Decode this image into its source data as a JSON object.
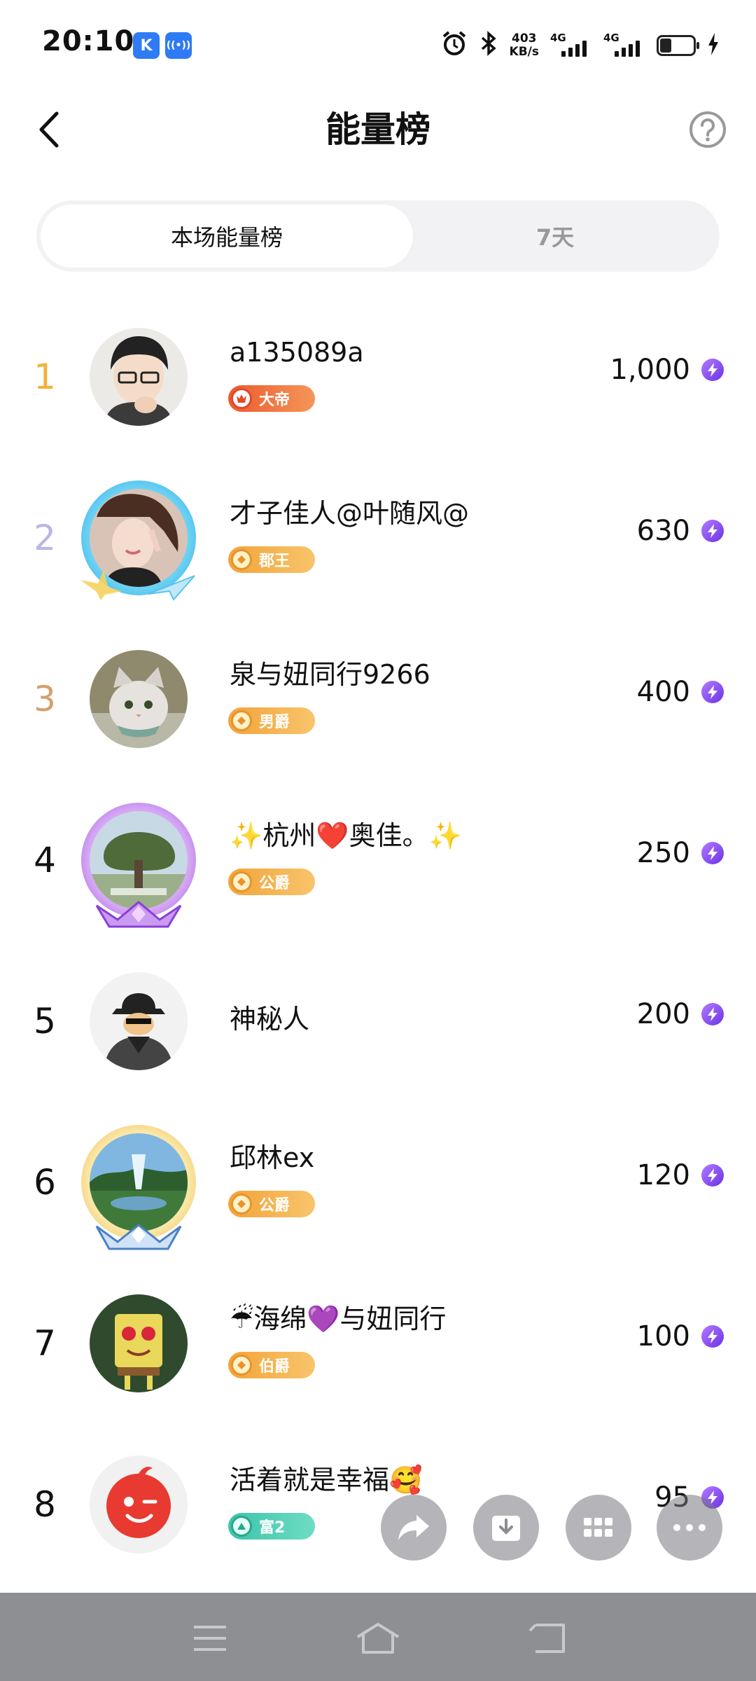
{
  "status_bar": {
    "time": "20:10",
    "app_badge_1": "K",
    "app_badge_2": "((•))",
    "net_speed_value": "403",
    "net_speed_unit": "KB/s",
    "network_1": "4G",
    "network_2": "4G",
    "icons": [
      "alarm-icon",
      "bluetooth-icon",
      "signal-icon",
      "battery-icon",
      "charging-icon"
    ]
  },
  "header": {
    "title": "能量榜",
    "back_icon": "chevron-left-icon",
    "help_icon": "question-circle-icon"
  },
  "tabs": [
    {
      "label": "本场能量榜",
      "active": true
    },
    {
      "label": "7天",
      "active": false
    }
  ],
  "leaderboard": [
    {
      "rank": "1",
      "name": "a135089a",
      "badge": "大帝",
      "badge_style": "red",
      "score": "1,000",
      "rank_color": "#f2b23a"
    },
    {
      "rank": "2",
      "name": "才子佳人@叶随风@",
      "badge": "郡王",
      "badge_style": "gold",
      "score": "630",
      "rank_color": "#b8b6e8"
    },
    {
      "rank": "3",
      "name": "泉与妞同行9266",
      "badge": "男爵",
      "badge_style": "gold",
      "score": "400",
      "rank_color": "#d5a06a"
    },
    {
      "rank": "4",
      "name": "✨杭州❤️奥佳。✨",
      "badge": "公爵",
      "badge_style": "gold",
      "score": "250",
      "rank_color": "#111111"
    },
    {
      "rank": "5",
      "name": "神秘人",
      "badge": "",
      "badge_style": "none",
      "score": "200",
      "rank_color": "#111111"
    },
    {
      "rank": "6",
      "name": "邱林ex",
      "badge": "公爵",
      "badge_style": "gold",
      "score": "120",
      "rank_color": "#111111"
    },
    {
      "rank": "7",
      "name": "☔海绵💜与妞同行",
      "badge": "伯爵",
      "badge_style": "gold",
      "score": "100",
      "rank_color": "#111111"
    },
    {
      "rank": "8",
      "name": "活着就是幸福🥰",
      "badge": "富2",
      "badge_style": "teal",
      "score": "95",
      "rank_color": "#111111"
    }
  ],
  "score_icon": "energy-bolt-icon",
  "floating_actions": [
    "share-icon",
    "download-icon",
    "grid-apps-icon",
    "more-icon"
  ],
  "nav_bar": [
    "menu-icon",
    "home-icon",
    "back-icon"
  ]
}
